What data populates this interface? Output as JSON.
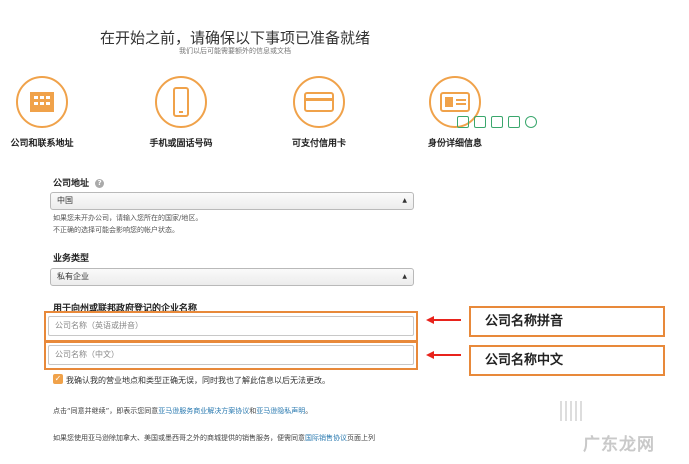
{
  "header": {
    "title": "在开始之前，请确保以下事项已准备就绪",
    "subtitle": "我们以后可能需要额外的信息或文档"
  },
  "steps": [
    {
      "label": "公司和联系地址",
      "icon": "building-icon"
    },
    {
      "label": "手机或固话号码",
      "icon": "phone-icon"
    },
    {
      "label": "可支付信用卡",
      "icon": "credit-card-icon"
    },
    {
      "label": "身份详细信息",
      "icon": "id-card-icon"
    }
  ],
  "form": {
    "address_label": "公司地址",
    "address_help": "?",
    "address_value": "中国",
    "address_hint_1": "如果您未开办公司，请输入您所在的国家/地区。",
    "address_hint_2": "不正确的选择可能会影响您的帐户状态。",
    "business_type_label": "业务类型",
    "business_type_value": "私有企业",
    "company_name_label": "用于向州或联邦政府登记的企业名称",
    "name_pinyin_placeholder": "公司名称（英语或拼音）",
    "name_chinese_placeholder": "公司名称（中文）",
    "confirm_text": "我确认我的营业地点和类型正确无误，同时我也了解此信息以后无法更改。",
    "agree_text_1": "点击“同意并继续”，即表示您同意",
    "agree_link_1": "亚马逊服务商业解决方案协议",
    "agree_text_2": "和",
    "agree_link_2": "亚马逊隐私声明",
    "agree_text_3": "。",
    "bottom_text": "如果您使用亚马逊除加拿大、美国或墨西哥之外的商城提供的销售服务，便需同意",
    "bottom_link": "国际销售协议",
    "bottom_text_2": "页面上列"
  },
  "annotations": {
    "pinyin_callout": "公司名称拼音",
    "chinese_callout": "公司名称中文"
  },
  "watermark": "广东龙网",
  "colors": {
    "accent_orange": "#f0a24a",
    "callout_border": "#e8893a",
    "arrow_red": "#e8231c",
    "toolbar_green": "#3aa76d"
  }
}
